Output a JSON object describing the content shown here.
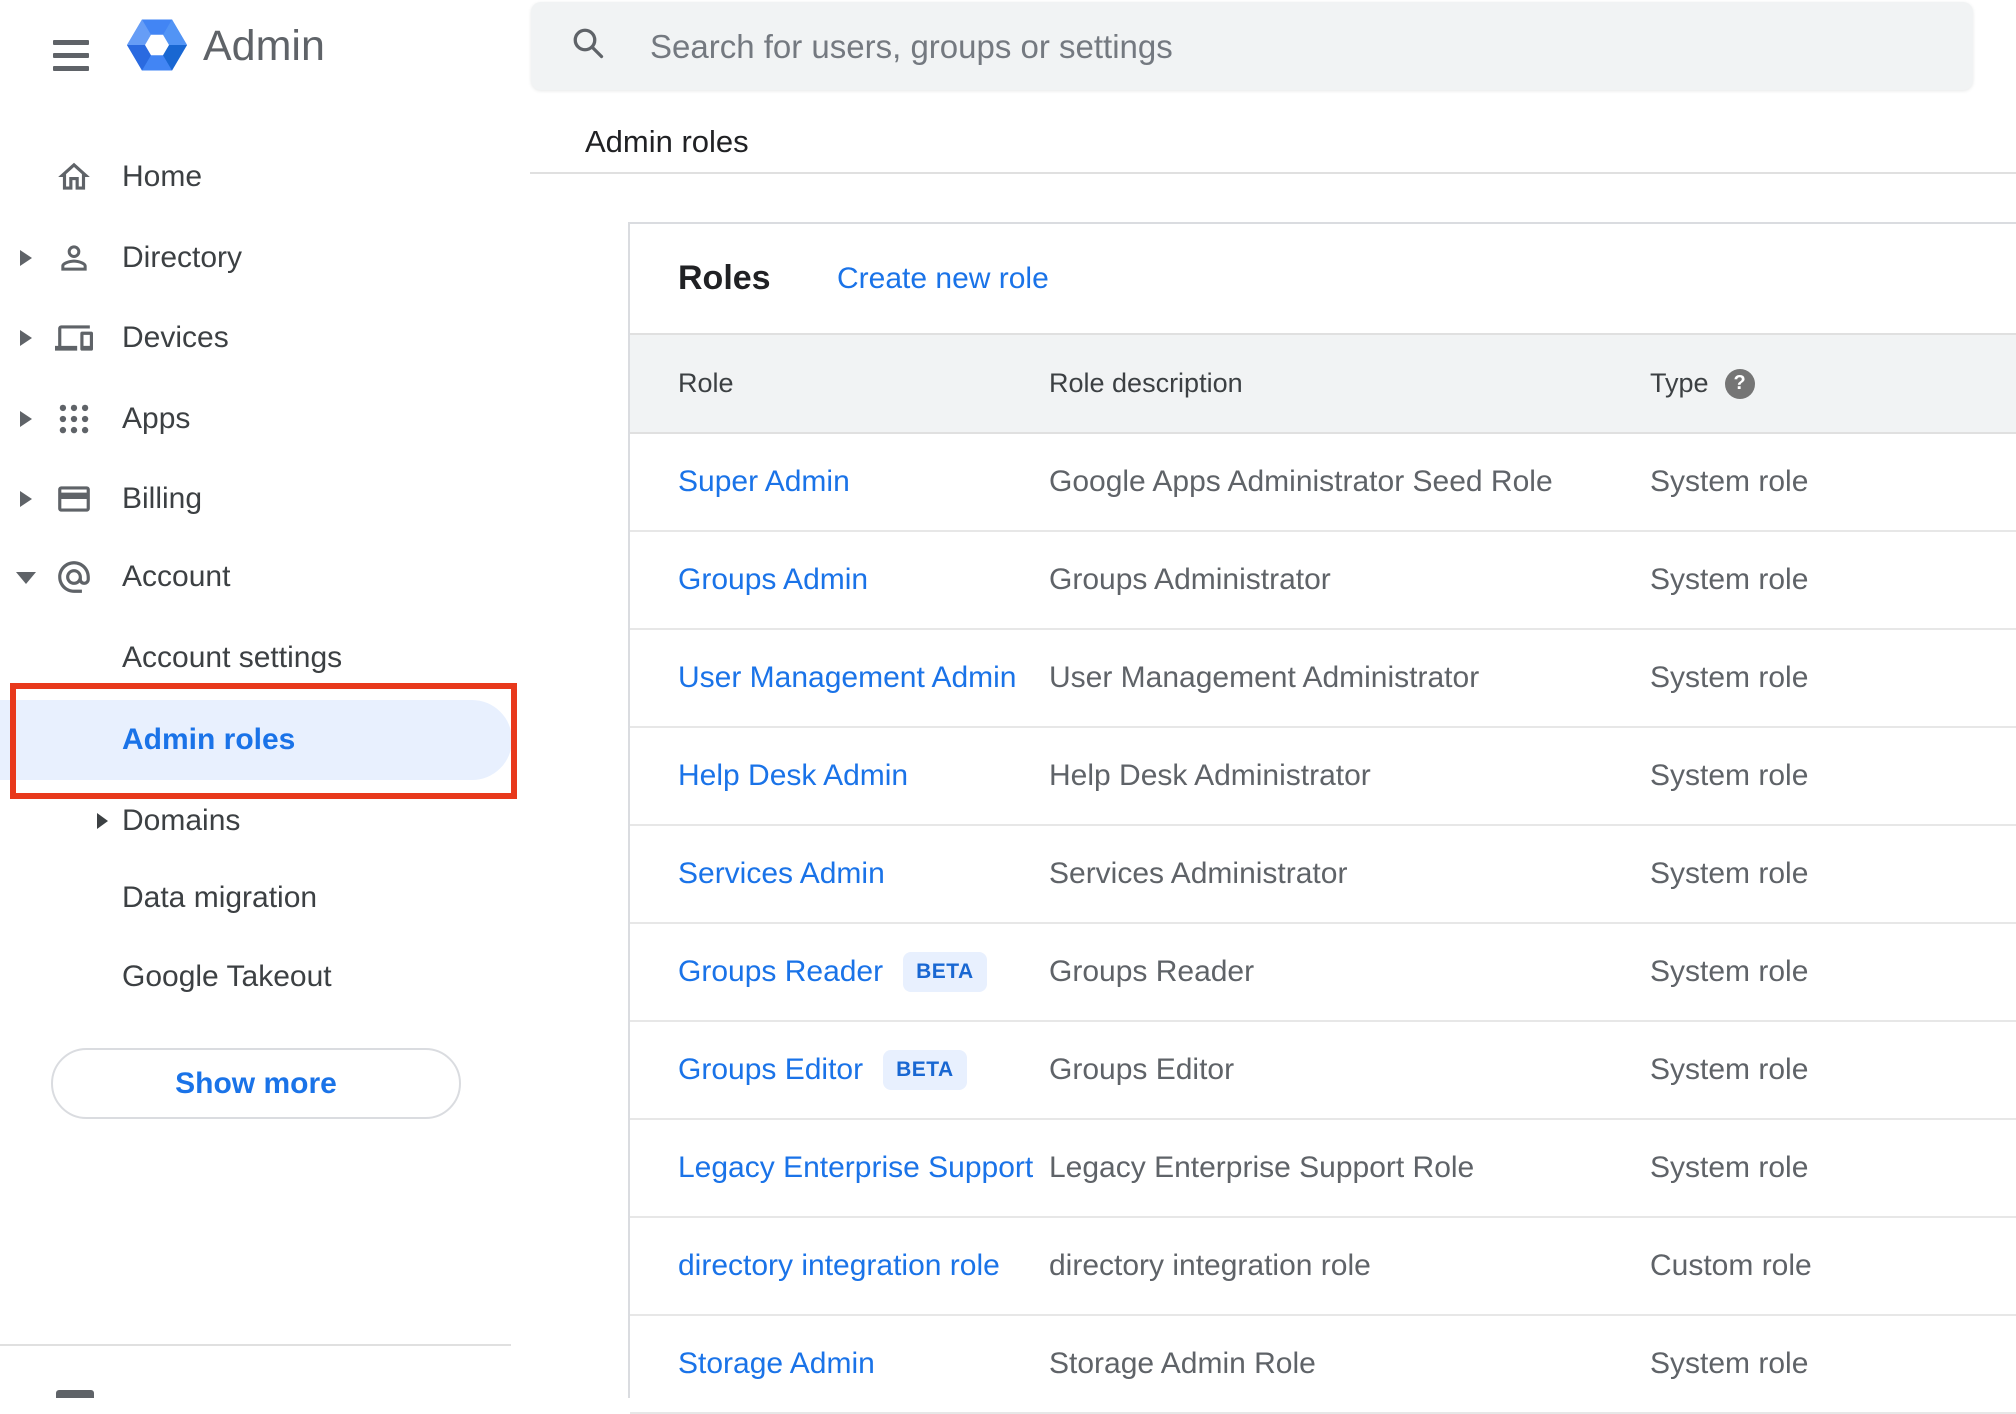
{
  "brand": {
    "name": "Admin"
  },
  "search": {
    "placeholder": "Search for users, groups or settings"
  },
  "page": {
    "title": "Admin roles"
  },
  "sidebar": {
    "items": [
      {
        "label": "Home",
        "icon": "home-icon",
        "expandable": false
      },
      {
        "label": "Directory",
        "icon": "person-icon",
        "expandable": true
      },
      {
        "label": "Devices",
        "icon": "devices-icon",
        "expandable": true
      },
      {
        "label": "Apps",
        "icon": "apps-grid-icon",
        "expandable": true
      },
      {
        "label": "Billing",
        "icon": "billing-card-icon",
        "expandable": true
      },
      {
        "label": "Account",
        "icon": "at-sign-icon",
        "expandable": true,
        "expanded": true
      }
    ],
    "account_children": [
      {
        "label": "Account settings",
        "selected": false
      },
      {
        "label": "Admin roles",
        "selected": true,
        "annotated": true
      },
      {
        "label": "Domains",
        "expandable": true
      },
      {
        "label": "Data migration"
      },
      {
        "label": "Google Takeout"
      }
    ],
    "show_more_label": "Show more"
  },
  "roles_card": {
    "title": "Roles",
    "create_link": "Create new role",
    "columns": {
      "role": "Role",
      "description": "Role description",
      "type": "Type"
    },
    "beta_label": "BETA",
    "rows": [
      {
        "role": "Super Admin",
        "beta": false,
        "description": "Google Apps Administrator Seed Role",
        "type": "System role"
      },
      {
        "role": "Groups Admin",
        "beta": false,
        "description": "Groups Administrator",
        "type": "System role"
      },
      {
        "role": "User Management Admin",
        "beta": false,
        "description": "User Management Administrator",
        "type": "System role"
      },
      {
        "role": "Help Desk Admin",
        "beta": false,
        "description": "Help Desk Administrator",
        "type": "System role"
      },
      {
        "role": "Services Admin",
        "beta": false,
        "description": "Services Administrator",
        "type": "System role"
      },
      {
        "role": "Groups Reader",
        "beta": true,
        "description": "Groups Reader",
        "type": "System role"
      },
      {
        "role": "Groups Editor",
        "beta": true,
        "description": "Groups Editor",
        "type": "System role"
      },
      {
        "role": "Legacy Enterprise Support",
        "beta": false,
        "description": "Legacy Enterprise Support Role",
        "type": "System role"
      },
      {
        "role": "directory integration role",
        "beta": false,
        "description": "directory integration role",
        "type": "Custom role"
      },
      {
        "role": "Storage Admin",
        "beta": false,
        "description": "Storage Admin Role",
        "type": "System role"
      }
    ]
  },
  "colors": {
    "accent_blue": "#1a73e8",
    "beta_blue": "#1967d2",
    "selected_bg": "#e8f0fe",
    "annotation_red": "#e8391c",
    "header_gray": "#f1f3f4",
    "icon_gray": "#5f6368"
  }
}
